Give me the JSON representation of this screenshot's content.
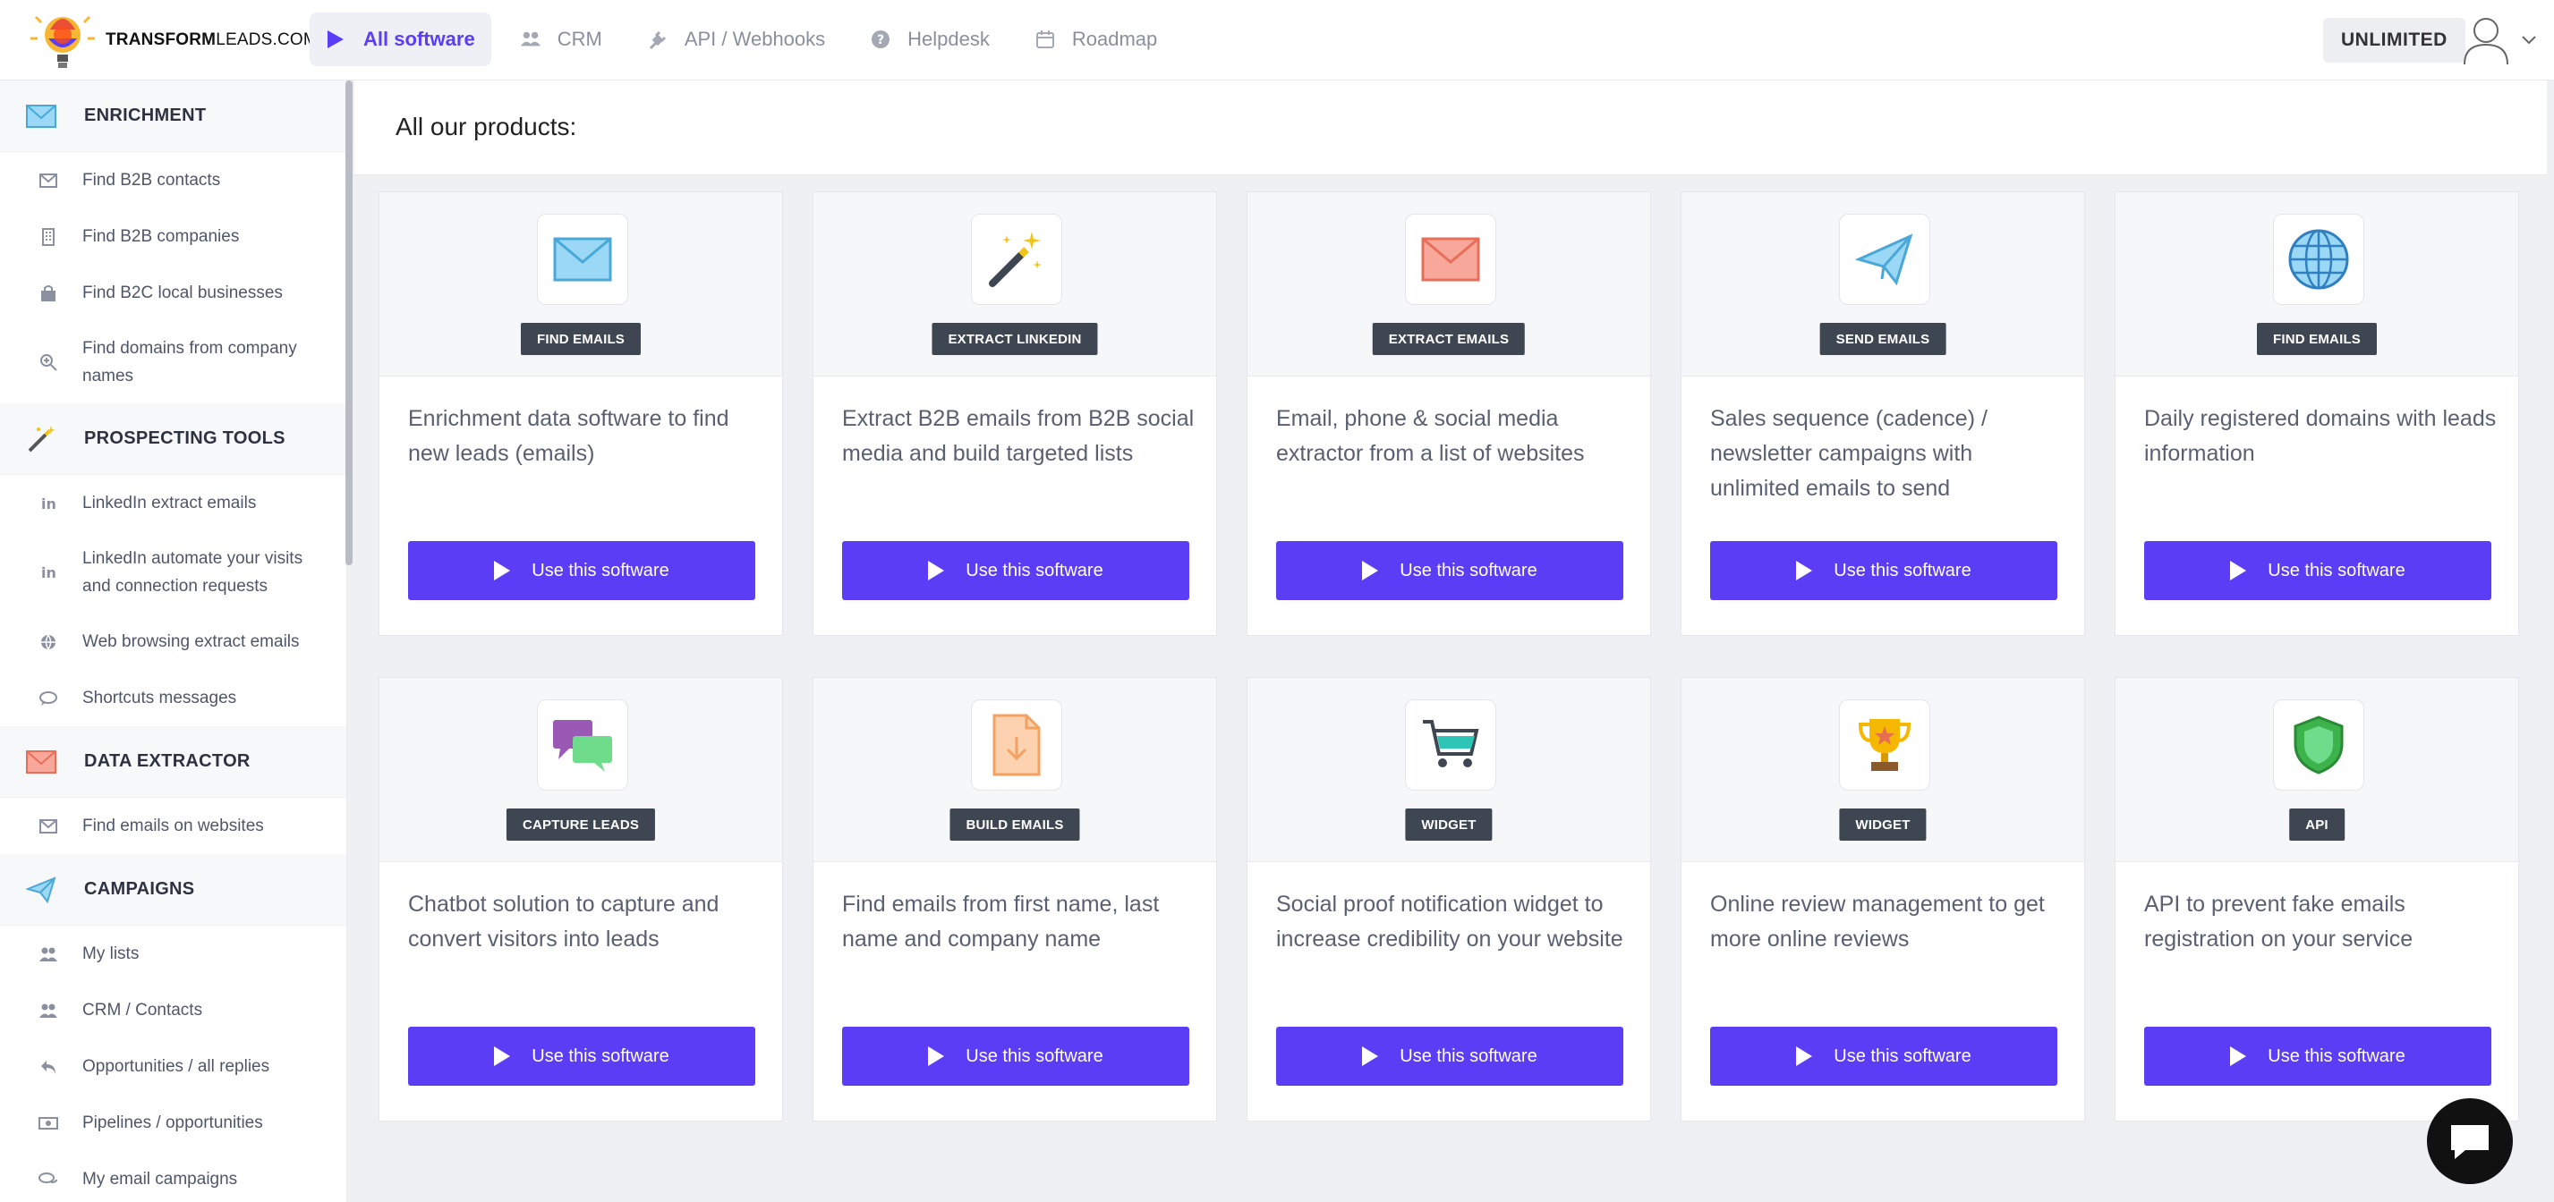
{
  "brand": {
    "bold": "TRANSFORM",
    "rest": "LEADS.COM"
  },
  "nav": [
    {
      "label": "All software",
      "icon": "play-icon",
      "active": true
    },
    {
      "label": "CRM",
      "icon": "users-icon"
    },
    {
      "label": "API / Webhooks",
      "icon": "plug-icon"
    },
    {
      "label": "Helpdesk",
      "icon": "question-icon"
    },
    {
      "label": "Roadmap",
      "icon": "calendar-icon"
    }
  ],
  "plan_badge": "UNLIMITED",
  "sidebar": {
    "sections": [
      {
        "title": "ENRICHMENT",
        "icon": "envelope-icon",
        "items": [
          {
            "label": "Find B2B contacts",
            "icon": "envelope-outline-icon"
          },
          {
            "label": "Find B2B companies",
            "icon": "building-icon"
          },
          {
            "label": "Find B2C local businesses",
            "icon": "shopping-bag-icon"
          },
          {
            "label": "Find domains from company names",
            "icon": "search-plus-icon"
          }
        ]
      },
      {
        "title": "PROSPECTING TOOLS",
        "icon": "magic-wand-icon",
        "items": [
          {
            "label": "LinkedIn extract emails",
            "icon": "linkedin-icon"
          },
          {
            "label": "LinkedIn automate your visits and connection requests",
            "icon": "linkedin-icon"
          },
          {
            "label": "Web browsing extract emails",
            "icon": "globe-icon"
          },
          {
            "label": "Shortcuts messages",
            "icon": "comment-icon"
          }
        ]
      },
      {
        "title": "DATA EXTRACTOR",
        "icon": "envelope-red-icon",
        "items": [
          {
            "label": "Find emails on websites",
            "icon": "envelope-outline-icon"
          }
        ]
      },
      {
        "title": "CAMPAIGNS",
        "icon": "paper-plane-icon",
        "items": [
          {
            "label": "My lists",
            "icon": "users-icon"
          },
          {
            "label": "CRM / Contacts",
            "icon": "users-icon"
          },
          {
            "label": "Opportunities / all replies",
            "icon": "reply-icon"
          },
          {
            "label": "Pipelines / opportunities",
            "icon": "money-icon"
          },
          {
            "label": "My email campaigns",
            "icon": "comments-icon"
          }
        ]
      }
    ]
  },
  "main": {
    "title": "All our products:",
    "button_label": "Use this software",
    "products": [
      {
        "badge": "FIND EMAILS",
        "icon": "envelope-blue-icon",
        "description": "Enrichment data software to find new leads (emails)"
      },
      {
        "badge": "EXTRACT LINKEDIN",
        "icon": "magic-wand-icon",
        "description": "Extract B2B emails from B2B social media and build targeted lists"
      },
      {
        "badge": "EXTRACT EMAILS",
        "icon": "envelope-red-icon",
        "description": "Email, phone & social media extractor from a list of websites"
      },
      {
        "badge": "SEND EMAILS",
        "icon": "paper-plane-icon",
        "description": "Sales sequence (cadence) / newsletter campaigns with unlimited emails to send"
      },
      {
        "badge": "FIND EMAILS",
        "icon": "globe-icon",
        "description": "Daily registered domains with leads information"
      },
      {
        "badge": "CAPTURE LEADS",
        "icon": "chat-bubbles-icon",
        "description": "Chatbot solution to capture and convert visitors into leads"
      },
      {
        "badge": "BUILD EMAILS",
        "icon": "file-download-icon",
        "description": "Find emails from first name, last name and company name"
      },
      {
        "badge": "WIDGET",
        "icon": "shopping-cart-icon",
        "description": "Social proof notification widget to increase credibility on your website"
      },
      {
        "badge": "WIDGET",
        "icon": "trophy-icon",
        "description": "Online review management to get more online reviews"
      },
      {
        "badge": "API",
        "icon": "shield-icon",
        "description": "API to prevent fake emails registration on your service"
      }
    ]
  },
  "colors": {
    "accent": "#5b3df5",
    "badge_bg": "#3e4652"
  }
}
